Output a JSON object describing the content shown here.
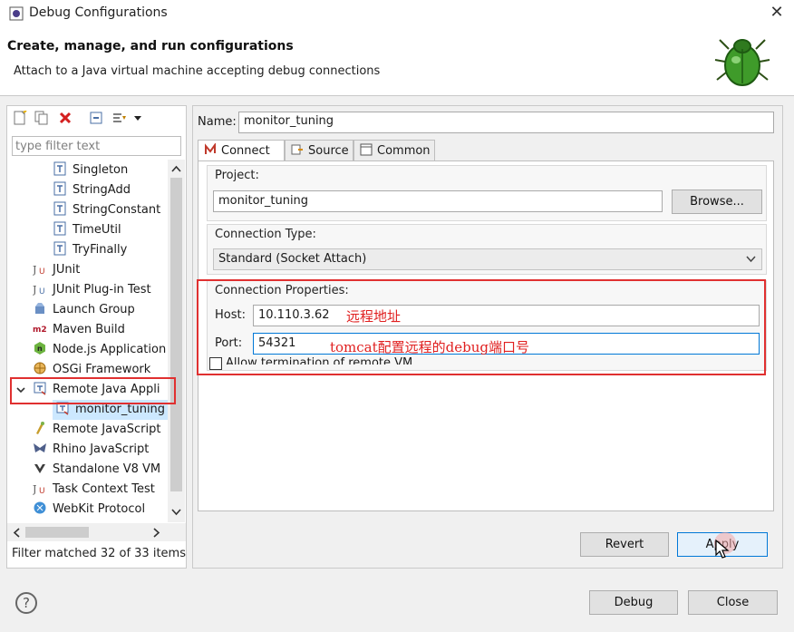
{
  "window": {
    "title": "Debug Configurations",
    "close_glyph": "✕"
  },
  "header": {
    "title": "Create, manage, and run configurations",
    "subtitle": "Attach to a Java virtual machine accepting debug connections",
    "icon": "bug-icon"
  },
  "left": {
    "toolbar_icons": [
      "new-config-icon",
      "duplicate-icon",
      "delete-icon",
      "collapse-all-icon",
      "filter-icon",
      "dropdown-arrow-icon"
    ],
    "filter_placeholder": "type filter text",
    "tree": [
      {
        "label": "Singleton",
        "indent": 2,
        "icon": "java-class-icon"
      },
      {
        "label": "StringAdd",
        "indent": 2,
        "icon": "java-class-icon"
      },
      {
        "label": "StringConstant",
        "indent": 2,
        "icon": "java-class-icon"
      },
      {
        "label": "TimeUtil",
        "indent": 2,
        "icon": "java-class-icon"
      },
      {
        "label": "TryFinally",
        "indent": 2,
        "icon": "java-class-icon"
      },
      {
        "label": "JUnit",
        "indent": 1,
        "icon": "junit-icon"
      },
      {
        "label": "JUnit Plug-in Test",
        "indent": 1,
        "icon": "junit-plugin-icon"
      },
      {
        "label": "Launch Group",
        "indent": 1,
        "icon": "launch-group-icon"
      },
      {
        "label": "Maven Build",
        "indent": 1,
        "icon": "maven-icon"
      },
      {
        "label": "Node.js Application",
        "indent": 1,
        "icon": "nodejs-icon"
      },
      {
        "label": "OSGi Framework",
        "indent": 1,
        "icon": "osgi-icon"
      },
      {
        "label": "Remote Java Appli",
        "indent": 1,
        "icon": "remote-java-icon",
        "expanded": true
      },
      {
        "label": "monitor_tuning",
        "indent": 2,
        "icon": "remote-java-icon",
        "selected": true
      },
      {
        "label": "Remote JavaScript",
        "indent": 1,
        "icon": "remote-js-icon"
      },
      {
        "label": "Rhino JavaScript",
        "indent": 1,
        "icon": "rhino-icon"
      },
      {
        "label": "Standalone V8 VM",
        "indent": 1,
        "icon": "v8-icon"
      },
      {
        "label": "Task Context Test",
        "indent": 1,
        "icon": "junit-icon"
      },
      {
        "label": "WebKit Protocol",
        "indent": 1,
        "icon": "webkit-icon"
      }
    ],
    "status": "Filter matched 32 of 33 items"
  },
  "right": {
    "name_label": "Name:",
    "name_value": "monitor_tuning",
    "tabs": [
      {
        "label": "Connect",
        "icon": "connect-icon",
        "active": true
      },
      {
        "label": "Source",
        "icon": "source-icon"
      },
      {
        "label": "Common",
        "icon": "common-icon"
      }
    ],
    "project": {
      "label": "Project:",
      "value": "monitor_tuning",
      "browse_label": "Browse..."
    },
    "connection_type": {
      "label": "Connection Type:",
      "value": "Standard (Socket Attach)"
    },
    "connection_props": {
      "label": "Connection Properties:",
      "host_label": "Host:",
      "host_value": "10.110.3.62",
      "port_label": "Port:",
      "port_value": "54321",
      "allow_termination_label": "Allow termination of remote VM"
    },
    "annotations": {
      "host_note": "远程地址",
      "port_note": "tomcat配置远程的debug端口号"
    },
    "revert_label": "Revert",
    "apply_label": "Apply"
  },
  "footer": {
    "debug_label": "Debug",
    "close_label": "Close",
    "help_glyph": "?"
  },
  "colors": {
    "annotation": "#e02020",
    "selection": "#cce8ff",
    "accent": "#0078d7"
  }
}
